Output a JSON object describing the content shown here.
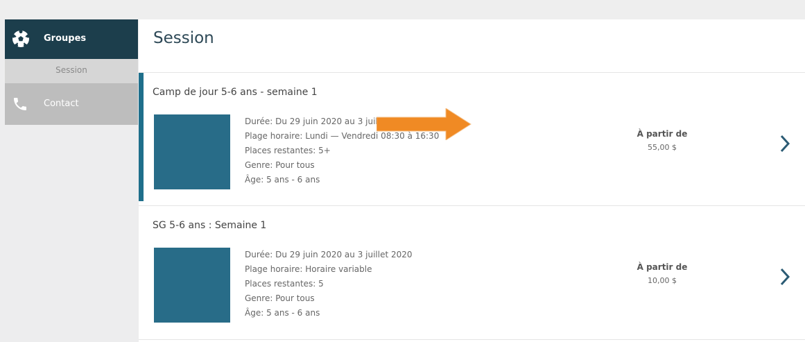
{
  "sidebar": {
    "items": [
      {
        "label": "Groupes",
        "icon": "soccer-ball-icon",
        "active": true
      },
      {
        "label": "Session",
        "sub": true
      },
      {
        "label": "Contact",
        "icon": "phone-icon"
      }
    ]
  },
  "main": {
    "title": "Session",
    "sessions": [
      {
        "title": "Camp de jour 5-6 ans - semaine 1",
        "duree": "Durée: Du 29 juin 2020 au 3 juillet 2020",
        "plage": "Plage horaire: Lundi — Vendredi 08:30 à 16:30",
        "places": "Places restantes: 5+",
        "genre": "Genre: Pour tous",
        "age": "Âge: 5 ans - 6 ans",
        "price_label": "À partir de",
        "price": "55,00 $"
      },
      {
        "title": "SG 5-6 ans : Semaine 1",
        "duree": "Durée: Du 29 juin 2020 au 3 juillet 2020",
        "plage": "Plage horaire: Horaire variable",
        "places": "Places restantes: 5",
        "genre": "Genre: Pour tous",
        "age": "Âge: 5 ans - 6 ans",
        "price_label": "À partir de",
        "price": "10,00 $"
      }
    ]
  },
  "colors": {
    "sidebar_active": "#1c3e4c",
    "accent": "#1f6f8b",
    "thumbnail": "#286c88",
    "arrow": "#f08a24"
  }
}
